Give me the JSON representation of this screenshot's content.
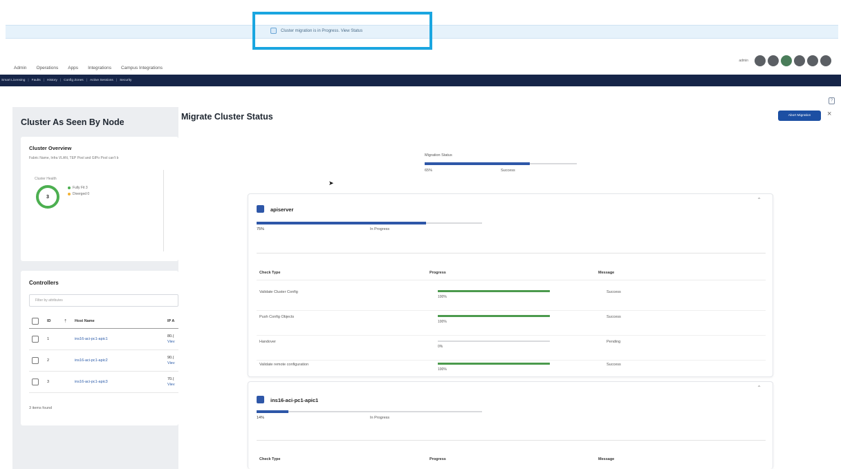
{
  "banner": {
    "text": "Cluster migration is in Progress. View Status"
  },
  "user": {
    "name": "admin"
  },
  "topnav": [
    "Admin",
    "Operations",
    "Apps",
    "Integrations",
    "Campus Integrations"
  ],
  "subnav": [
    "Smart Licensing",
    "Faults",
    "History",
    "Config Zones",
    "Active Sessions",
    "Security"
  ],
  "left": {
    "title": "Cluster As Seen By Node",
    "overview": {
      "title": "Cluster Overview",
      "subtitle": "Fabric Name, Infra VLAN, TEP Pool and GIPo Pool can't b",
      "health_label": "Cluster Health",
      "health_value": "3",
      "legend": [
        {
          "label": "Fully Fit",
          "count": "3",
          "color": "#4caf50"
        },
        {
          "label": "Diverged",
          "count": "0",
          "color": "#f2b233"
        }
      ]
    },
    "controllers": {
      "title": "Controllers",
      "filter_placeholder": "Filter by attributes",
      "headers": {
        "id": "ID",
        "host": "Host Name",
        "ip": "IP A"
      },
      "rows": [
        {
          "id": "1",
          "host": "ins16-aci-pc1-apic1",
          "ip": "80.(",
          "view": "Viev"
        },
        {
          "id": "2",
          "host": "ins16-aci-pc1-apic2",
          "ip": "90.(",
          "view": "Viev"
        },
        {
          "id": "3",
          "host": "ins16-aci-pc1-apic3",
          "ip": "70.(",
          "view": "Viev"
        }
      ],
      "items_found": "3 items found"
    }
  },
  "panel": {
    "title": "Migrate Cluster Status",
    "abort_label": "Abort Migration",
    "close": "×",
    "migration": {
      "label": "Migration Status",
      "percent_text": "65%",
      "progress": 0.69,
      "state": "Success"
    },
    "nodes": [
      {
        "name": "apiserver",
        "percent_text": "75%",
        "progress": 0.75,
        "state": "In Progress",
        "headers": {
          "type": "Check Type",
          "progress": "Progress",
          "message": "Message"
        },
        "checks": [
          {
            "type": "Validate Cluster Config",
            "percent_text": "100%",
            "progress": 1.0,
            "message": "Success"
          },
          {
            "type": "Push Config Objects",
            "percent_text": "100%",
            "progress": 1.0,
            "message": "Success"
          },
          {
            "type": "Handover",
            "percent_text": "0%",
            "progress": 0.0,
            "message": "Pending"
          },
          {
            "type": "Validate remote configuration",
            "percent_text": "100%",
            "progress": 1.0,
            "message": "Success"
          }
        ]
      },
      {
        "name": "ins16-aci-pc1-apic1",
        "percent_text": "14%",
        "progress": 0.14,
        "state": "In Progress",
        "headers": {
          "type": "Check Type",
          "progress": "Progress",
          "message": "Message"
        }
      }
    ]
  }
}
